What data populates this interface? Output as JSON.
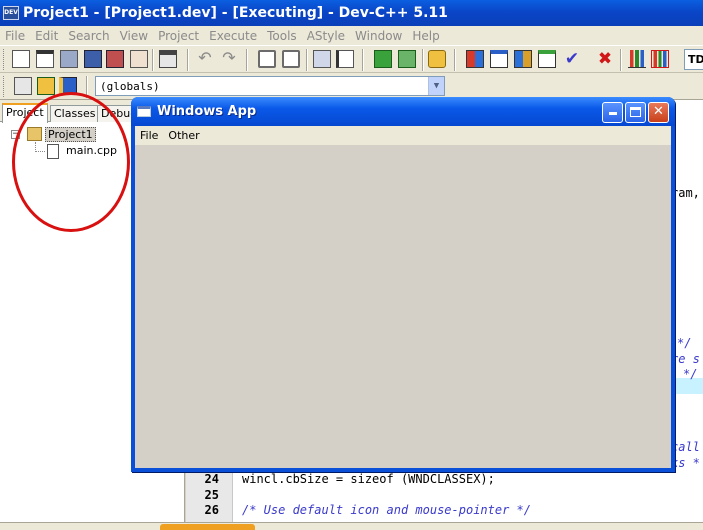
{
  "main_window": {
    "title": "Project1 - [Project1.dev] - [Executing] - Dev-C++ 5.11",
    "icon_text": "DEV"
  },
  "menu": [
    "File",
    "Edit",
    "Search",
    "View",
    "Project",
    "Execute",
    "Tools",
    "AStyle",
    "Window",
    "Help"
  ],
  "toolbar": {
    "combo_value": "TD",
    "scope_combo": "(globals)"
  },
  "project_panel": {
    "tabs": [
      "Project",
      "Classes",
      "Debug"
    ],
    "tree": {
      "project": "Project1",
      "file": "main.cpp"
    }
  },
  "editor": {
    "lines": [
      {
        "num": "24",
        "code": "wincl.cbSize = sizeof (WNDCLASSEX);"
      },
      {
        "num": "25",
        "code": ""
      },
      {
        "num": "26",
        "code": "/* Use default icon and mouse-pointer */"
      }
    ],
    "fragments": [
      "ram,",
      "*/",
      "re s",
      "*/",
      "call",
      "ks *"
    ]
  },
  "app_window": {
    "title": "Windows App",
    "menu": [
      "File",
      "Other"
    ]
  },
  "colors": {
    "title_blue": "#0a46c8",
    "annotation_red": "#d81010"
  }
}
